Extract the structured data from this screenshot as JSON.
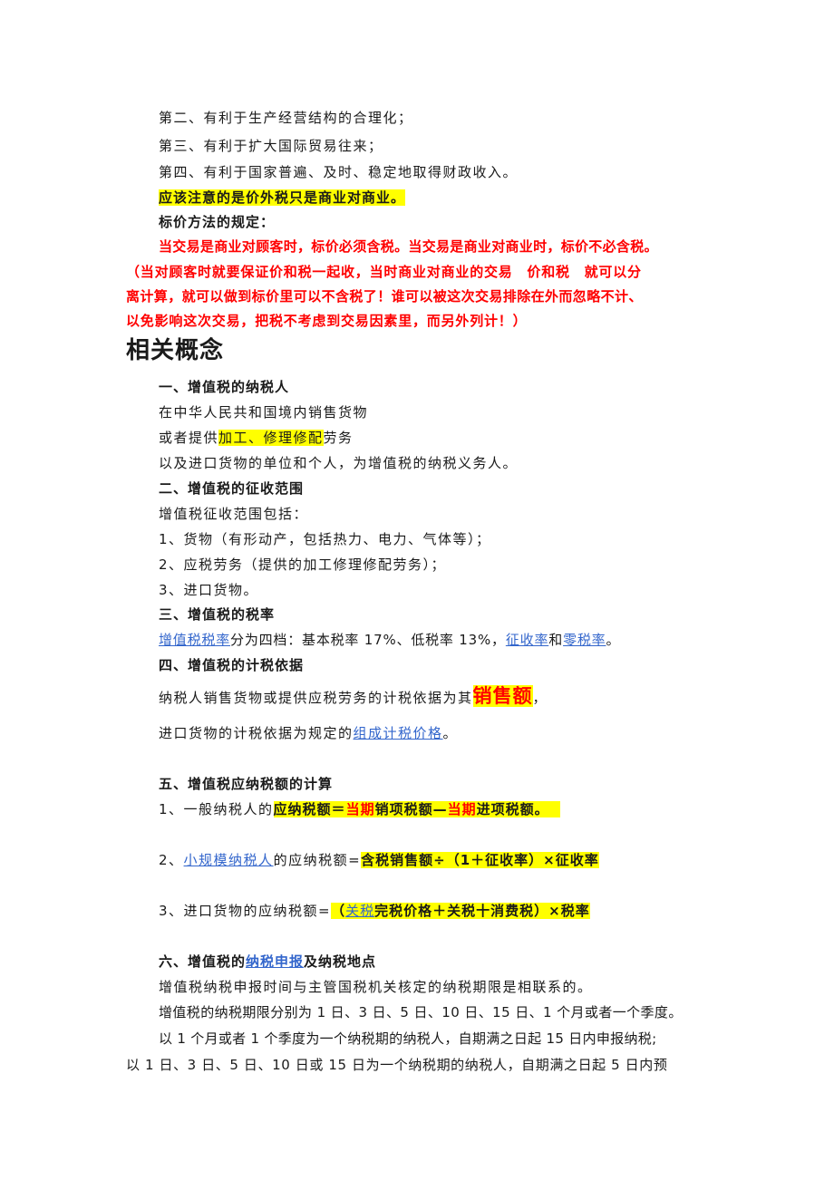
{
  "intro": {
    "p2": "第二、有利于生产经营结构的合理化；",
    "p3": "第三、有利于扩大国际贸易往来；",
    "p4": "第四、有利于国家普遍、及时、稳定地取得财政收入。",
    "note": "应该注意的是价外税只是商业对商业。",
    "pricing_title": "标价方法的规定：",
    "pricing_rule": "当交易是商业对顾客时，标价必须含税。当交易是商业对商业时，标价不必含税。",
    "explain_1": "（当对顾客时就要保证价和税一起收，当时商业对商业的交易　价和税　就可以分",
    "explain_2": "离计算，就可以做到标价里可以不含税了！谁可以被这次交易排除在外而忽略不计、",
    "explain_3": "以免影响这次交易，把税不考虑到交易因素里，而另外列计！）"
  },
  "section_title": "相关概念",
  "s1": {
    "title": "一、增值税的纳税人",
    "l1": "在中华人民共和国境内销售货物",
    "l2_pre": "或者提供",
    "l2_hl": "加工、修理修配",
    "l2_post": "劳务",
    "l3": "以及进口货物的单位和个人，为增值税的纳税义务人。"
  },
  "s2": {
    "title": "二、增值税的征收范围",
    "l1": "增值税征收范围包括：",
    "l2": "1、货物（有形动产，包括热力、电力、气体等）；",
    "l3": "2、应税劳务（提供的加工修理修配劳务）；",
    "l4": "3、进口货物。"
  },
  "s3": {
    "title": "三、增值税的税率",
    "link1": "增值税税率",
    "mid": "分为四档：基本税率 17%、低税率 13%，",
    "link2": "征收率",
    "and": "和",
    "link3": "零税率",
    "end": "。"
  },
  "s4": {
    "title": "四、增值税的计税依据",
    "l1_pre": "纳税人销售货物或提供应税劳务的计税依据为其",
    "l1_hl": "销售额",
    "l1_post": "，",
    "l2_pre": "进口货物的计税依据为规定的",
    "l2_link": "组成计税价格",
    "l2_post": "。"
  },
  "s5": {
    "title": "五、增值税应纳税额的计算",
    "f1_pre": "1、一般纳税人的",
    "f1_a": "应纳税额＝",
    "f1_b": "当期",
    "f1_c": "销项税额—",
    "f1_d": "当期",
    "f1_e": "进项税额。",
    "f2_pre": "2、",
    "f2_link": "小规模纳税人",
    "f2_mid": "的应纳税额=",
    "f2_hl": "含税销售额÷（1＋征收率）×征收率",
    "f3_pre": "3、进口货物的应纳税额=",
    "f3_a": "（",
    "f3_link": "关税",
    "f3_b": "完税价格＋关税十消费税）×税率"
  },
  "s6": {
    "title_pre": "六、增值税的",
    "title_link": "纳税申报",
    "title_post": "及纳税地点",
    "l1": "增值税纳税申报时间与主管国税机关核定的纳税期限是相联系的。",
    "l2": "增值税的纳税期限分别为 1 日、3 日、5 日、10 日、15 日、1 个月或者一个季度。",
    "l3": "以 1 个月或者 1 个季度为一个纳税期的纳税人，自期满之日起 15 日内申报纳税;",
    "l4": "以 1 日、3 日、5 日、10 日或 15 日为一个纳税期的纳税人，自期满之日起 5 日内预"
  }
}
